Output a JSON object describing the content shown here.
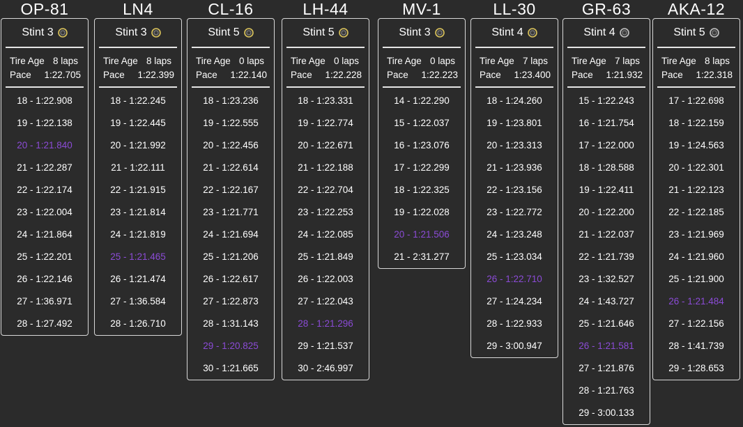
{
  "labels": {
    "tire_age": "Tire Age",
    "pace": "Pace"
  },
  "colors": {
    "background": "#2b2b2b",
    "text": "#ffffff",
    "best_lap": "#8b4bd6",
    "tire_medium": "#d9c25a",
    "tire_hard": "#bfbfbf"
  },
  "drivers": [
    {
      "name": "OP-81",
      "stint": "Stint 3",
      "tire_icon": "tire-medium-icon",
      "tire_age": "8 laps",
      "pace": "1:22.705",
      "laps": [
        "18 - 1:22.908",
        "19 - 1:22.138",
        "20 - 1:21.840",
        "21 - 1:22.287",
        "22 - 1:22.174",
        "23 - 1:22.004",
        "24 - 1:21.864",
        "25 - 1:22.201",
        "26 - 1:22.146",
        "27 - 1:36.971",
        "28 - 1:27.492"
      ],
      "best_index": 2
    },
    {
      "name": "LN4",
      "stint": "Stint 3",
      "tire_icon": "tire-medium-icon",
      "tire_age": "8 laps",
      "pace": "1:22.399",
      "laps": [
        "18 - 1:22.245",
        "19 - 1:22.445",
        "20 - 1:21.992",
        "21 - 1:22.111",
        "22 - 1:21.915",
        "23 - 1:21.814",
        "24 - 1:21.819",
        "25 - 1:21.465",
        "26 - 1:21.474",
        "27 - 1:36.584",
        "28 - 1:26.710"
      ],
      "best_index": 7
    },
    {
      "name": "CL-16",
      "stint": "Stint 5",
      "tire_icon": "tire-medium-icon",
      "tire_age": "0 laps",
      "pace": "1:22.140",
      "laps": [
        "18 - 1:23.236",
        "19 - 1:22.555",
        "20 - 1:22.456",
        "21 - 1:22.614",
        "22 - 1:22.167",
        "23 - 1:21.771",
        "24 - 1:21.694",
        "25 - 1:21.206",
        "26 - 1:22.617",
        "27 - 1:22.873",
        "28 - 1:31.143",
        "29 - 1:20.825",
        "30 - 1:21.665"
      ],
      "best_index": 11
    },
    {
      "name": "LH-44",
      "stint": "Stint 5",
      "tire_icon": "tire-medium-icon",
      "tire_age": "0 laps",
      "pace": "1:22.228",
      "laps": [
        "18 - 1:23.331",
        "19 - 1:22.774",
        "20 - 1:22.671",
        "21 - 1:22.188",
        "22 - 1:22.704",
        "23 - 1:22.253",
        "24 - 1:22.085",
        "25 - 1:21.849",
        "26 - 1:22.003",
        "27 - 1:22.043",
        "28 - 1:21.296",
        "29 - 1:21.537",
        "30 - 2:46.997"
      ],
      "best_index": 10
    },
    {
      "name": "MV-1",
      "stint": "Stint 3",
      "tire_icon": "tire-medium-icon",
      "tire_age": "0 laps",
      "pace": "1:22.223",
      "laps": [
        "14 - 1:22.290",
        "15 - 1:22.037",
        "16 - 1:23.076",
        "17 - 1:22.299",
        "18 - 1:22.325",
        "19 - 1:22.028",
        "20 - 1:21.506",
        "21 - 2:31.277"
      ],
      "best_index": 6
    },
    {
      "name": "LL-30",
      "stint": "Stint 4",
      "tire_icon": "tire-medium-icon",
      "tire_age": "7 laps",
      "pace": "1:23.400",
      "laps": [
        "18 - 1:24.260",
        "19 - 1:23.801",
        "20 - 1:23.313",
        "21 - 1:23.936",
        "22 - 1:23.156",
        "23 - 1:22.772",
        "24 - 1:23.248",
        "25 - 1:23.034",
        "26 - 1:22.710",
        "27 - 1:24.234",
        "28 - 1:22.933",
        "29 - 3:00.947"
      ],
      "best_index": 8
    },
    {
      "name": "GR-63",
      "stint": "Stint 4",
      "tire_icon": "tire-hard-icon",
      "tire_age": "7 laps",
      "pace": "1:21.932",
      "laps": [
        "15 - 1:22.243",
        "16 - 1:21.754",
        "17 - 1:22.000",
        "18 - 1:28.588",
        "19 - 1:22.411",
        "20 - 1:22.200",
        "21 - 1:22.037",
        "22 - 1:21.739",
        "23 - 1:32.527",
        "24 - 1:43.727",
        "25 - 1:21.646",
        "26 - 1:21.581",
        "27 - 1:21.876",
        "28 - 1:21.763",
        "29 - 3:00.133"
      ],
      "best_index": 11
    },
    {
      "name": "AKA-12",
      "stint": "Stint 5",
      "tire_icon": "tire-hard-icon",
      "tire_age": "8 laps",
      "pace": "1:22.318",
      "laps": [
        "17 - 1:22.698",
        "18 - 1:22.159",
        "19 - 1:24.563",
        "20 - 1:22.301",
        "21 - 1:22.123",
        "22 - 1:22.185",
        "23 - 1:21.969",
        "24 - 1:21.960",
        "25 - 1:21.900",
        "26 - 1:21.484",
        "27 - 1:22.156",
        "28 - 1:41.739",
        "29 - 1:28.653"
      ],
      "best_index": 9
    }
  ]
}
